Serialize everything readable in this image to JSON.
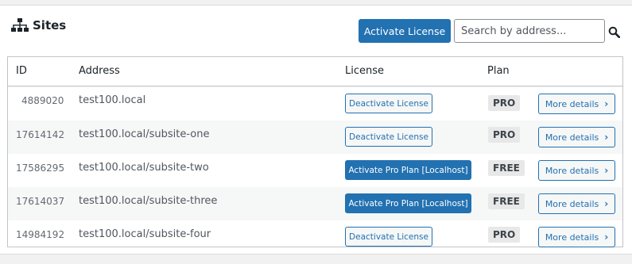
{
  "header": {
    "title": "Sites",
    "activate_button": "Activate License",
    "search_placeholder": "Search by address..."
  },
  "table": {
    "columns": [
      "ID",
      "Address",
      "License",
      "Plan"
    ],
    "rows": [
      {
        "id": "4889020",
        "address": "test100.local",
        "license_button": "Deactivate License",
        "license_style": "secondary",
        "plan": "PRO",
        "details_button": "More details"
      },
      {
        "id": "17614142",
        "address": "test100.local/subsite-one",
        "license_button": "Deactivate License",
        "license_style": "secondary",
        "plan": "PRO",
        "details_button": "More details"
      },
      {
        "id": "17586295",
        "address": "test100.local/subsite-two",
        "license_button": "Activate Pro Plan [Localhost]",
        "license_style": "primary",
        "plan": "FREE",
        "details_button": "More details"
      },
      {
        "id": "17614037",
        "address": "test100.local/subsite-three",
        "license_button": "Activate Pro Plan [Localhost]",
        "license_style": "primary",
        "plan": "FREE",
        "details_button": "More details"
      },
      {
        "id": "14984192",
        "address": "test100.local/subsite-four",
        "license_button": "Deactivate License",
        "license_style": "secondary",
        "plan": "PRO",
        "details_button": "More details"
      }
    ]
  },
  "icons": {
    "sites": "sitemap-icon",
    "search": "search-icon",
    "chevron": "chevron-right-icon"
  },
  "colors": {
    "accent": "#2271b1",
    "badge_bg": "#e8e8e8",
    "row_alt": "#f6f7f7"
  }
}
